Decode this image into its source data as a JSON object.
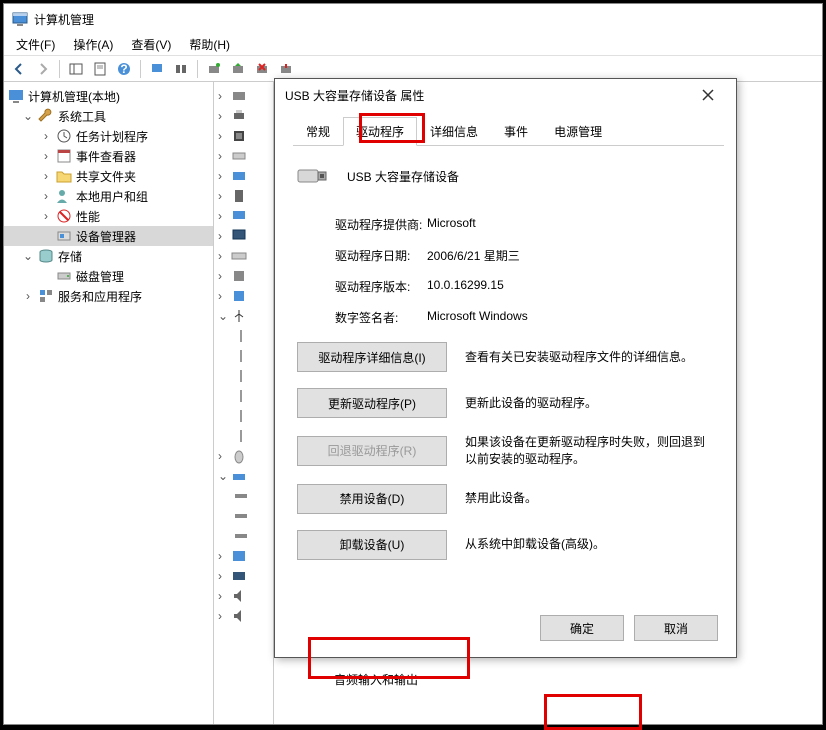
{
  "main_window": {
    "title": "计算机管理",
    "menus": [
      "文件(F)",
      "操作(A)",
      "查看(V)",
      "帮助(H)"
    ]
  },
  "tree": {
    "root": "计算机管理(本地)",
    "system_tools": "系统工具",
    "task_scheduler": "任务计划程序",
    "event_viewer": "事件查看器",
    "shared_folders": "共享文件夹",
    "local_users": "本地用户和组",
    "performance": "性能",
    "device_manager": "设备管理器",
    "storage": "存储",
    "disk_mgmt": "磁盘管理",
    "services_apps": "服务和应用程序"
  },
  "audio_label": "音频输入和输出",
  "dialog": {
    "title": "USB 大容量存储设备 属性",
    "tabs": {
      "general": "常规",
      "driver": "驱动程序",
      "details": "详细信息",
      "events": "事件",
      "power": "电源管理"
    },
    "device_name": "USB 大容量存储设备",
    "rows": {
      "provider_k": "驱动程序提供商:",
      "provider_v": "Microsoft",
      "date_k": "驱动程序日期:",
      "date_v": "2006/6/21 星期三",
      "version_k": "驱动程序版本:",
      "version_v": "10.0.16299.15",
      "signer_k": "数字签名者:",
      "signer_v": "Microsoft Windows"
    },
    "actions": {
      "details_btn": "驱动程序详细信息(I)",
      "details_desc": "查看有关已安装驱动程序文件的详细信息。",
      "update_btn": "更新驱动程序(P)",
      "update_desc": "更新此设备的驱动程序。",
      "rollback_btn": "回退驱动程序(R)",
      "rollback_desc": "如果该设备在更新驱动程序时失败，则回退到以前安装的驱动程序。",
      "disable_btn": "禁用设备(D)",
      "disable_desc": "禁用此设备。",
      "uninstall_btn": "卸载设备(U)",
      "uninstall_desc": "从系统中卸载设备(高级)。"
    },
    "ok": "确定",
    "cancel": "取消"
  }
}
